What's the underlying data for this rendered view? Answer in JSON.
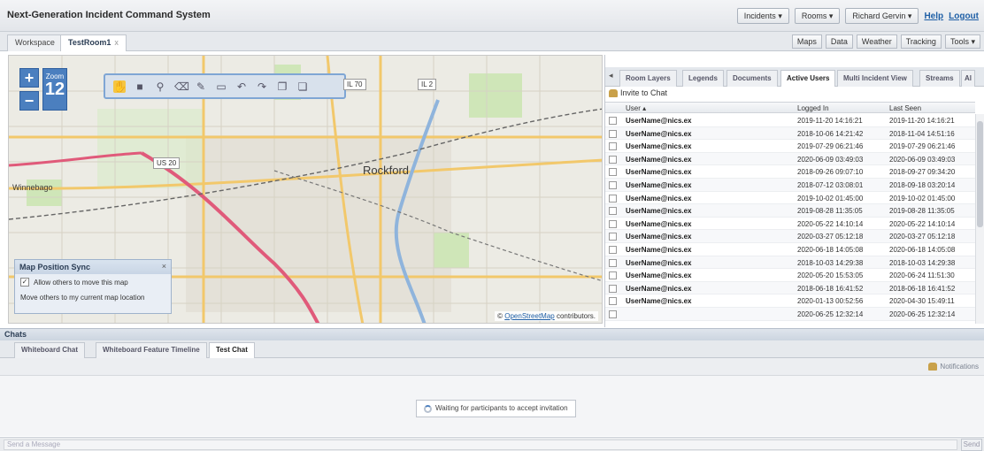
{
  "app": {
    "title": "Next-Generation Incident Command System",
    "nav": {
      "incidents": "Incidents",
      "rooms": "Rooms",
      "user": "Richard Gervin",
      "help": "Help",
      "logout": "Logout"
    }
  },
  "workspace_tabs": [
    {
      "label": "Workspace",
      "active": false
    },
    {
      "label": "TestRoom1",
      "active": true,
      "close": "x"
    }
  ],
  "toolbar_right": [
    "Maps",
    "Data",
    "Weather",
    "Tracking",
    "Tools"
  ],
  "map": {
    "zoom_label": "Zoom",
    "zoom_level": "12",
    "city_label": "Rockford",
    "winnebago_label": "Winnebago",
    "badge_il70": "IL 70",
    "badge_il2": "IL 2",
    "badge_us20": "US 20",
    "attribution_prefix": "©",
    "attribution_link": "OpenStreetMap",
    "attribution_suffix": "contributors.",
    "sync_title": "Map Position Sync",
    "sync_close": "×",
    "sync_allow": "Allow others to move this map",
    "sync_allow_checked": true,
    "sync_move_others": "Move others to my current map location"
  },
  "right_panel": {
    "tabs": [
      {
        "label": "Room Layers",
        "active": false
      },
      {
        "label": "Legends",
        "active": false
      },
      {
        "label": "Documents",
        "active": false
      },
      {
        "label": "Active Users",
        "active": true
      },
      {
        "label": "Multi Incident View",
        "active": false
      },
      {
        "label": "Streams",
        "active": false
      },
      {
        "label": "Al",
        "active": false
      }
    ],
    "invite": "Invite to Chat",
    "columns": {
      "user": "User",
      "logged_in": "Logged In",
      "last_seen": "Last Seen"
    },
    "rows": [
      {
        "user": "UserName@nics.ex",
        "logged_in": "2019-11-20 14:16:21",
        "last_seen": "2019-11-20 14:16:21"
      },
      {
        "user": "UserName@nics.ex",
        "logged_in": "2018-10-06 14:21:42",
        "last_seen": "2018-11-04 14:51:16"
      },
      {
        "user": "UserName@nics.ex",
        "logged_in": "2019-07-29 06:21:46",
        "last_seen": "2019-07-29 06:21:46"
      },
      {
        "user": "UserName@nics.ex",
        "logged_in": "2020-06-09 03:49:03",
        "last_seen": "2020-06-09 03:49:03"
      },
      {
        "user": "UserName@nics.ex",
        "logged_in": "2018-09-26 09:07:10",
        "last_seen": "2018-09-27 09:34:20"
      },
      {
        "user": "UserName@nics.ex",
        "logged_in": "2018-07-12 03:08:01",
        "last_seen": "2018-09-18 03:20:14"
      },
      {
        "user": "UserName@nics.ex",
        "logged_in": "2019-10-02 01:45:00",
        "last_seen": "2019-10-02 01:45:00"
      },
      {
        "user": "UserName@nics.ex",
        "logged_in": "2019-08-28 11:35:05",
        "last_seen": "2019-08-28 11:35:05"
      },
      {
        "user": "UserName@nics.ex",
        "logged_in": "2020-05-22 14:10:14",
        "last_seen": "2020-05-22 14:10:14"
      },
      {
        "user": "UserName@nics.ex",
        "logged_in": "2020-03-27 05:12:18",
        "last_seen": "2020-03-27 05:12:18"
      },
      {
        "user": "UserName@nics.ex",
        "logged_in": "2020-06-18 14:05:08",
        "last_seen": "2020-06-18 14:05:08"
      },
      {
        "user": "UserName@nics.ex",
        "logged_in": "2018-10-03 14:29:38",
        "last_seen": "2018-10-03 14:29:38"
      },
      {
        "user": "UserName@nics.ex",
        "logged_in": "2020-05-20 15:53:05",
        "last_seen": "2020-06-24 11:51:30"
      },
      {
        "user": "UserName@nics.ex",
        "logged_in": "2018-06-18 16:41:52",
        "last_seen": "2018-06-18 16:41:52"
      },
      {
        "user": "UserName@nics.ex",
        "logged_in": "2020-01-13 00:52:56",
        "last_seen": "2020-04-30 15:49:11"
      },
      {
        "user": "",
        "logged_in": "2020-06-25 12:32:14",
        "last_seen": "2020-06-25 12:32:14"
      }
    ]
  },
  "chats": {
    "header": "Chats",
    "tabs": [
      {
        "label": "Whiteboard Chat",
        "active": false
      },
      {
        "label": "Whiteboard Feature Timeline",
        "active": false
      },
      {
        "label": "Test Chat",
        "active": true
      }
    ],
    "notifications": "Notifications",
    "waiting": "Waiting for participants to accept invitation",
    "message_placeholder": "Send a Message",
    "send": "Send"
  }
}
